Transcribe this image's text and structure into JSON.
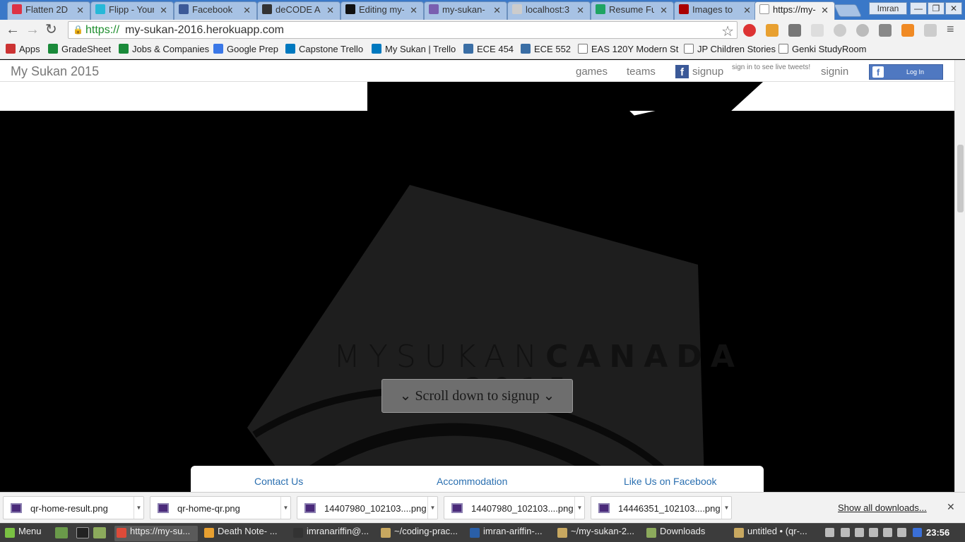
{
  "tabs": [
    {
      "title": "Flatten 2D",
      "fav": "#d34",
      "active": false
    },
    {
      "title": "Flipp - Your",
      "fav": "#27b8d8",
      "active": false
    },
    {
      "title": "Facebook",
      "fav": "#3b5998",
      "active": false
    },
    {
      "title": "deCODE A",
      "fav": "#333",
      "active": false
    },
    {
      "title": "Editing my-",
      "fav": "#111",
      "active": false
    },
    {
      "title": "my-sukan-",
      "fav": "#7a5fb0",
      "active": false
    },
    {
      "title": "localhost:3",
      "fav": "#ccc",
      "active": false
    },
    {
      "title": "Resume Fu",
      "fav": "#1fa463",
      "active": false
    },
    {
      "title": "Images to",
      "fav": "#a00",
      "active": false
    },
    {
      "title": "https://my-",
      "fav": "#fff",
      "active": true
    }
  ],
  "user": "Imran",
  "url": {
    "scheme": "https://",
    "rest": "my-sukan-2016.herokuapp.com"
  },
  "bookmarks": [
    {
      "label": "Apps",
      "color": "#c33"
    },
    {
      "label": "GradeSheet",
      "color": "#1a8a3a"
    },
    {
      "label": "Jobs & Companies",
      "color": "#1a8a3a"
    },
    {
      "label": "Google Prep",
      "color": "#3b78e7"
    },
    {
      "label": "Capstone Trello",
      "color": "#0079bf"
    },
    {
      "label": "My Sukan | Trello",
      "color": "#0079bf"
    },
    {
      "label": "ECE 454",
      "color": "#3a6ea5"
    },
    {
      "label": "ECE 552",
      "color": "#3a6ea5"
    },
    {
      "label": "EAS 120Y Modern St",
      "color": "#fff"
    },
    {
      "label": "JP Children Stories",
      "color": "#fff"
    },
    {
      "label": "Genki StudyRoom",
      "color": "#fff"
    }
  ],
  "site": {
    "brand": "My Sukan 2015",
    "nav": {
      "games": "games",
      "teams": "teams",
      "signup": "signup",
      "tweets": "sign in to see live tweets!",
      "signin": "signin",
      "fb_login": "Log In"
    },
    "hero": {
      "title_thin": "MYSUKAN",
      "title_bold": "CANADA",
      "year": "2015"
    },
    "scroll_button": "Scroll down to signup",
    "footer": {
      "contact": "Contact Us",
      "accommodation": "Accommodation",
      "facebook": "Like Us on Facebook"
    }
  },
  "downloads": [
    "qr-home-result.png",
    "qr-home-qr.png",
    "14407980_102103....png",
    "14407980_102103....png",
    "14446351_102103....png"
  ],
  "show_all": "Show all downloads...",
  "taskbar": {
    "menu": "Menu",
    "items": [
      {
        "label": "https://my-su...",
        "active": true
      },
      {
        "label": "Death Note- ...",
        "active": false
      },
      {
        "label": "imranariffin@...",
        "active": false
      },
      {
        "label": "~/coding-prac...",
        "active": false
      },
      {
        "label": "imran-ariffin-...",
        "active": false
      },
      {
        "label": "~/my-sukan-2...",
        "active": false
      },
      {
        "label": "Downloads",
        "active": false
      },
      {
        "label": "untitled • (qr-...",
        "active": false
      }
    ],
    "clock": "23:56"
  }
}
